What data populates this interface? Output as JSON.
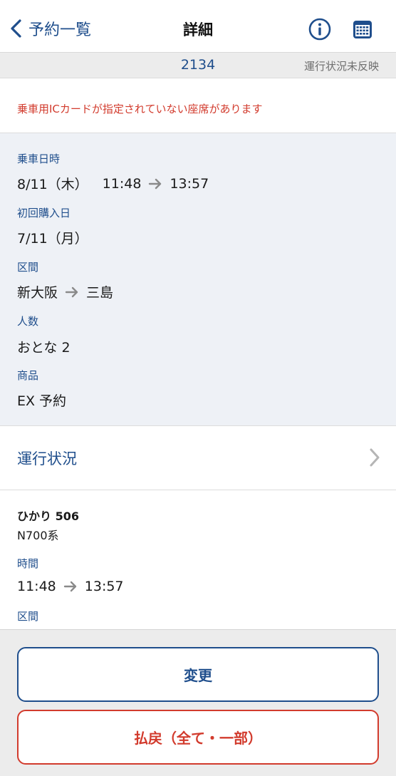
{
  "header": {
    "back_label": "予約一覧",
    "title": "詳細"
  },
  "status_strip": {
    "number": "2134",
    "status_text": "運行状況未反映"
  },
  "warning": {
    "text": "乗車用ICカードが指定されていない座席があります"
  },
  "details": {
    "ride_datetime": {
      "label": "乗車日時",
      "date": "8/11（木）",
      "depart": "11:48",
      "arrive": "13:57"
    },
    "first_purchase": {
      "label": "初回購入日",
      "value": "7/11（月）"
    },
    "section": {
      "label": "区間",
      "from": "新大阪",
      "to": "三島"
    },
    "people": {
      "label": "人数",
      "value": "おとな 2"
    },
    "product": {
      "label": "商品",
      "value": "EX 予約"
    }
  },
  "running_status": {
    "label": "運行状況"
  },
  "train": {
    "name": "ひかり 506",
    "type": "N700系",
    "time": {
      "label": "時間",
      "depart": "11:48",
      "arrive": "13:57"
    },
    "section_label": "区間"
  },
  "actions": {
    "change_label": "変更",
    "refund_label": "払戻（全て・一部）"
  },
  "colors": {
    "accent": "#1f4e8c",
    "warning": "#d23b2d",
    "details_bg": "#eef1f6",
    "strip_bg": "#ececec"
  },
  "icons": [
    "chevron-left-icon",
    "info-icon",
    "calendar-icon",
    "arrow-right-icon",
    "chevron-right-icon"
  ]
}
